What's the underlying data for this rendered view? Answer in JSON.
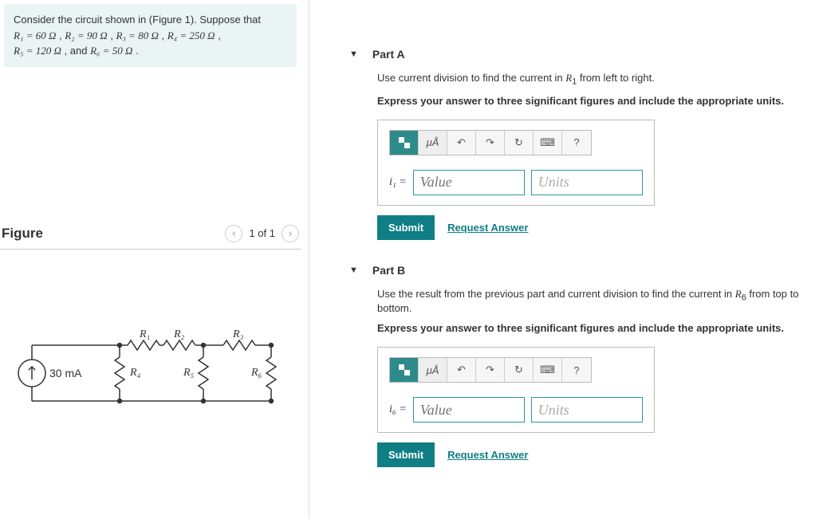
{
  "prompt": {
    "intro": "Consider the circuit shown in (Figure 1). Suppose that",
    "r1": "R₁ = 60  Ω",
    "r2": "R₂ = 90  Ω",
    "r3": "R₃ = 80  Ω",
    "r4": "R₄ = 250  Ω",
    "r5": "R₅ = 120  Ω",
    "r6": "R₆ = 50  Ω",
    "and": "and"
  },
  "figure": {
    "heading": "Figure",
    "pager": "1 of 1",
    "current_source": "30 mA",
    "labels": {
      "R1": "R₁",
      "R2": "R₂",
      "R3": "R₃",
      "R4": "R₄",
      "R5": "R₅",
      "R6": "R₆"
    }
  },
  "partA": {
    "title": "Part A",
    "prompt": "Use current division to find the current in R₁ from left to right.",
    "instruction": "Express your answer to three significant figures and include the appropriate units.",
    "var": "i₁ =",
    "value_ph": "Value",
    "units_ph": "Units"
  },
  "partB": {
    "title": "Part B",
    "prompt": "Use the result from the previous part and current division to find the current in R₆ from top to bottom.",
    "instruction": "Express your answer to three significant figures and include the appropriate units.",
    "var": "i₆ =",
    "value_ph": "Value",
    "units_ph": "Units"
  },
  "toolbar": {
    "units_btn": "μÅ",
    "help": "?"
  },
  "buttons": {
    "submit": "Submit",
    "request": "Request Answer"
  }
}
